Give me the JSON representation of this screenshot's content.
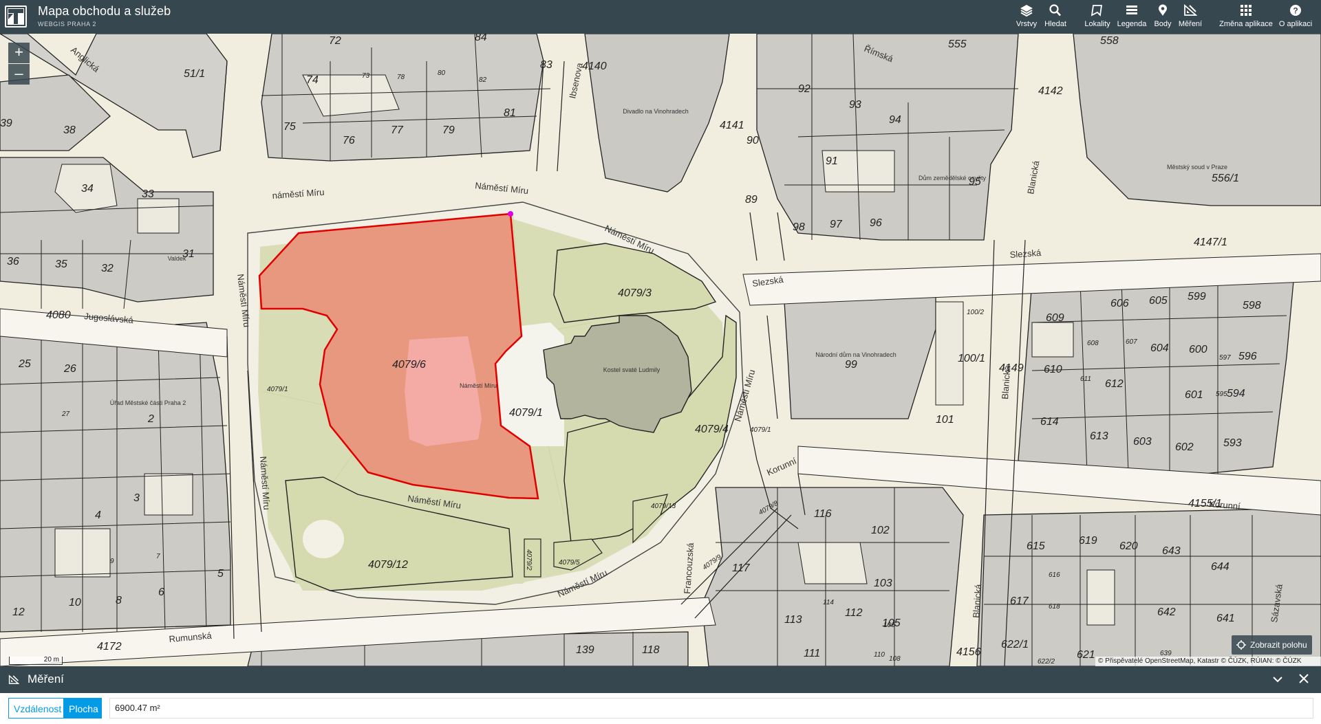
{
  "header": {
    "title": "Mapa obchodu a služeb",
    "subtitle": "WEBGIS PRAHA 2",
    "nav": [
      {
        "label": "Vrstvy",
        "icon": "layers-icon"
      },
      {
        "label": "Hledat",
        "icon": "search-icon"
      },
      {
        "label": "Lokality",
        "icon": "bookmark-icon"
      },
      {
        "label": "Legenda",
        "icon": "legend-icon"
      },
      {
        "label": "Body",
        "icon": "map-pin-icon"
      },
      {
        "label": "Měření",
        "icon": "measure-icon"
      },
      {
        "label": "Změna aplikace",
        "icon": "app-grid-icon"
      },
      {
        "label": "O aplikaci",
        "icon": "help-icon"
      }
    ]
  },
  "map": {
    "zoom_in": "+",
    "zoom_out": "–",
    "scale": "20 m",
    "locate_label": "Zobrazit polohu",
    "attribution": "© Přispěvatelé OpenStreetMap, Katastr © ČÚZK, RÚIAN: © ČÚZK",
    "selection_color": "#e8987f",
    "selection_outline": "#e00000",
    "streets": {
      "namesti_miru": "Náměstí Míru",
      "namesti_miru_lower": "náměstí Míru",
      "rimska": "Římská",
      "anglicka": "Anglická",
      "ibsenova": "Ibsenova",
      "slezska": "Slezská",
      "jugoslavska": "Jugoslávská",
      "blanicka": "Blanická",
      "korunni": "Korunní",
      "francouzska": "Francouzská",
      "rumunska": "Rumunská",
      "sazavska": "Sázavská"
    },
    "parcels": {
      "p4079_6": "4079/6",
      "p4079_3": "4079/3",
      "p4079_1": "4079/1",
      "p4079_4": "4079/4",
      "p4079_12": "4079/12",
      "p4079_5": "4079/5",
      "p4079_2": "4079/2",
      "p4079_13": "4079/13",
      "p4141": "4141",
      "p4140": "4140",
      "p4142": "4142",
      "p4147_1": "4147/1",
      "p4080": "4080",
      "p4149": "4149",
      "p4155_1": "4155/1",
      "p4156": "4156",
      "p4172": "4172",
      "p556_1": "556/1",
      "p100_1": "100/1",
      "p622_1": "622/1",
      "p51_1": "51/1",
      "n555": "555",
      "n558": "558",
      "n72": "72",
      "n84": "84",
      "n83": "83",
      "n74": "74",
      "n75": "75",
      "n76": "76",
      "n77": "77",
      "n79": "79",
      "n81": "81",
      "n73": "73",
      "n78": "78",
      "n80": "80",
      "n82": "82",
      "n38": "38",
      "n39": "39",
      "n34": "34",
      "n33": "33",
      "n31": "31",
      "n32": "32",
      "n35": "35",
      "n36": "36",
      "n25": "25",
      "n26": "26",
      "n27": "27",
      "n2": "2",
      "n3": "3",
      "n4": "4",
      "n5": "5",
      "n6": "6",
      "n7": "7",
      "n8": "8",
      "n9": "9",
      "n10": "10",
      "n12": "12",
      "n92": "92",
      "n93": "93",
      "n94": "94",
      "n90": "90",
      "n91": "91",
      "n95": "95",
      "n89": "89",
      "n98": "98",
      "n97": "97",
      "n96": "96",
      "n609": "609",
      "n606": "606",
      "n605": "605",
      "n599": "599",
      "n598": "598",
      "n608": "608",
      "n607": "607",
      "n604": "604",
      "n600": "600",
      "n597": "597",
      "n596": "596",
      "n610": "610",
      "n611": "611",
      "n612": "612",
      "n601": "601",
      "n595": "595",
      "n594": "594",
      "n614": "614",
      "n613": "613",
      "n603": "603",
      "n602": "602",
      "n593": "593",
      "n99": "99",
      "n101": "101",
      "n100_2": "100/2",
      "n116": "116",
      "n117": "117",
      "n102": "102",
      "n103": "103",
      "n113": "113",
      "n114": "114",
      "n112": "112",
      "n106": "106",
      "n105": "105",
      "n111": "111",
      "n110": "110",
      "n108": "108",
      "n615": "615",
      "n619": "619",
      "n620": "620",
      "n643": "643",
      "n644": "644",
      "n616": "616",
      "n617": "617",
      "n618": "618",
      "n642": "642",
      "n641": "641",
      "n621": "621",
      "n639": "639",
      "n622_2": "622/2",
      "n139": "139",
      "n118": "118",
      "n140": "140",
      "n141": "141",
      "n4079_1b": "4079/1",
      "n4079_8": "4079/8",
      "n4079_9": "4079/9",
      "n4079_7": "4079/7",
      "n4079_10": "4079/10"
    },
    "pois": {
      "square": "Náměstí Míru",
      "church": "Kostel svaté Ludmily",
      "theatre": "Divadlo na Vinohradech",
      "narodni_dum": "Národní dům na Vinohradech",
      "urad": "Úřad Městské části Praha 2",
      "dum_zemedelske": "Dům zemědělské osvěty",
      "mestsky_soud": "Městský soud v Praze",
      "valdek": "Valdek"
    }
  },
  "measure": {
    "title": "Měření",
    "mode_distance": "Vzdálenost",
    "mode_area": "Plocha",
    "active_mode": "Plocha",
    "result": "6900.47 m²"
  }
}
